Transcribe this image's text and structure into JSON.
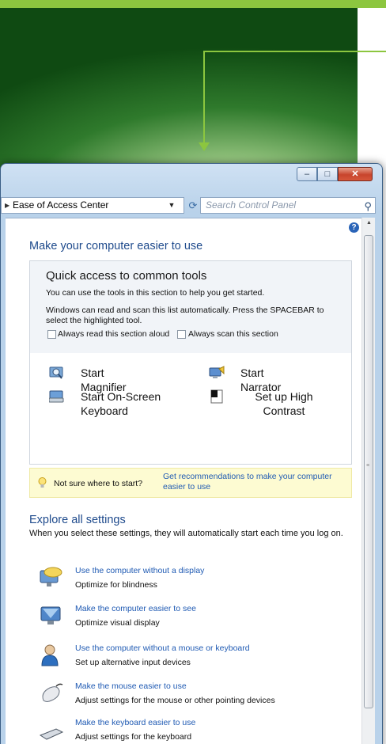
{
  "window": {
    "minimize_glyph": "–",
    "maximize_glyph": "□",
    "close_glyph": "✕"
  },
  "address": {
    "location": "Ease of Access Center",
    "search_placeholder": "Search Control Panel"
  },
  "main": {
    "title": "Make your computer easier to use",
    "quick_access": {
      "title": "Quick access to common tools",
      "desc1": "You can use the tools in this section to help you get started.",
      "desc2": "Windows can read and scan this list automatically.  Press the SPACEBAR to select the highlighted tool.",
      "checkbox_read": "Always read this section aloud",
      "checkbox_scan": "Always scan this section",
      "tools": {
        "magnifier": "Start Magnifier",
        "narrator": "Start Narrator",
        "osk": "Start On-Screen Keyboard",
        "high_contrast": "Set up High Contrast"
      }
    },
    "tip": {
      "text": "Not sure where to start?",
      "link": "Get recommendations to make your computer easier to use"
    },
    "explore": {
      "title": "Explore all settings",
      "desc": "When you select these settings, they will automatically start each time you log on.",
      "items": [
        {
          "link": "Use the computer without a display",
          "sub": "Optimize for blindness",
          "icon": "display-speech-icon"
        },
        {
          "link": "Make the computer easier to see",
          "sub": "Optimize visual display",
          "icon": "monitor-icon"
        },
        {
          "link": "Use the computer without a mouse or keyboard",
          "sub": "Set up alternative input devices",
          "icon": "user-icon"
        },
        {
          "link": "Make the mouse easier to use",
          "sub": "Adjust settings for the mouse or other pointing devices",
          "icon": "mouse-icon"
        },
        {
          "link": "Make the keyboard easier to use",
          "sub": "Adjust settings for the keyboard",
          "icon": "keyboard-icon"
        }
      ]
    }
  },
  "colors": {
    "accent_green": "#8cc63f",
    "link_blue": "#1f5ab3",
    "heading_blue": "#1e4a8c",
    "tip_background": "#fdfbd2"
  }
}
